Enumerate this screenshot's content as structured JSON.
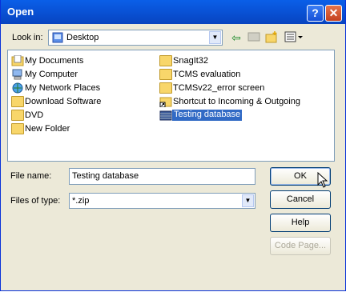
{
  "window": {
    "title": "Open",
    "help_glyph": "?",
    "close_glyph": "✕"
  },
  "lookin": {
    "label": "Look in:",
    "value": "Desktop"
  },
  "toolbar": {
    "back_icon": "back-arrow-icon",
    "up_icon": "up-folder-icon",
    "new_folder_icon": "new-folder-icon",
    "views_icon": "views-menu-icon"
  },
  "files": [
    {
      "name": "My Documents",
      "icon": "my-documents-icon"
    },
    {
      "name": "My Computer",
      "icon": "my-computer-icon"
    },
    {
      "name": "My Network Places",
      "icon": "network-places-icon"
    },
    {
      "name": "Download Software",
      "icon": "folder-icon"
    },
    {
      "name": "DVD",
      "icon": "folder-icon"
    },
    {
      "name": "New Folder",
      "icon": "folder-icon"
    },
    {
      "name": "SnagIt32",
      "icon": "folder-icon"
    },
    {
      "name": "TCMS evaluation",
      "icon": "folder-icon"
    },
    {
      "name": "TCMSv22_error screen",
      "icon": "folder-icon"
    },
    {
      "name": "Shortcut to Incoming & Outgoing",
      "icon": "shortcut-icon"
    },
    {
      "name": "Testing database",
      "icon": "database-icon"
    }
  ],
  "filename": {
    "label": "File name:",
    "value": "Testing database"
  },
  "filetype": {
    "label": "Files of type:",
    "value": "*.zip"
  },
  "buttons": {
    "ok": "OK",
    "cancel": "Cancel",
    "help": "Help",
    "codepage": "Code Page..."
  }
}
